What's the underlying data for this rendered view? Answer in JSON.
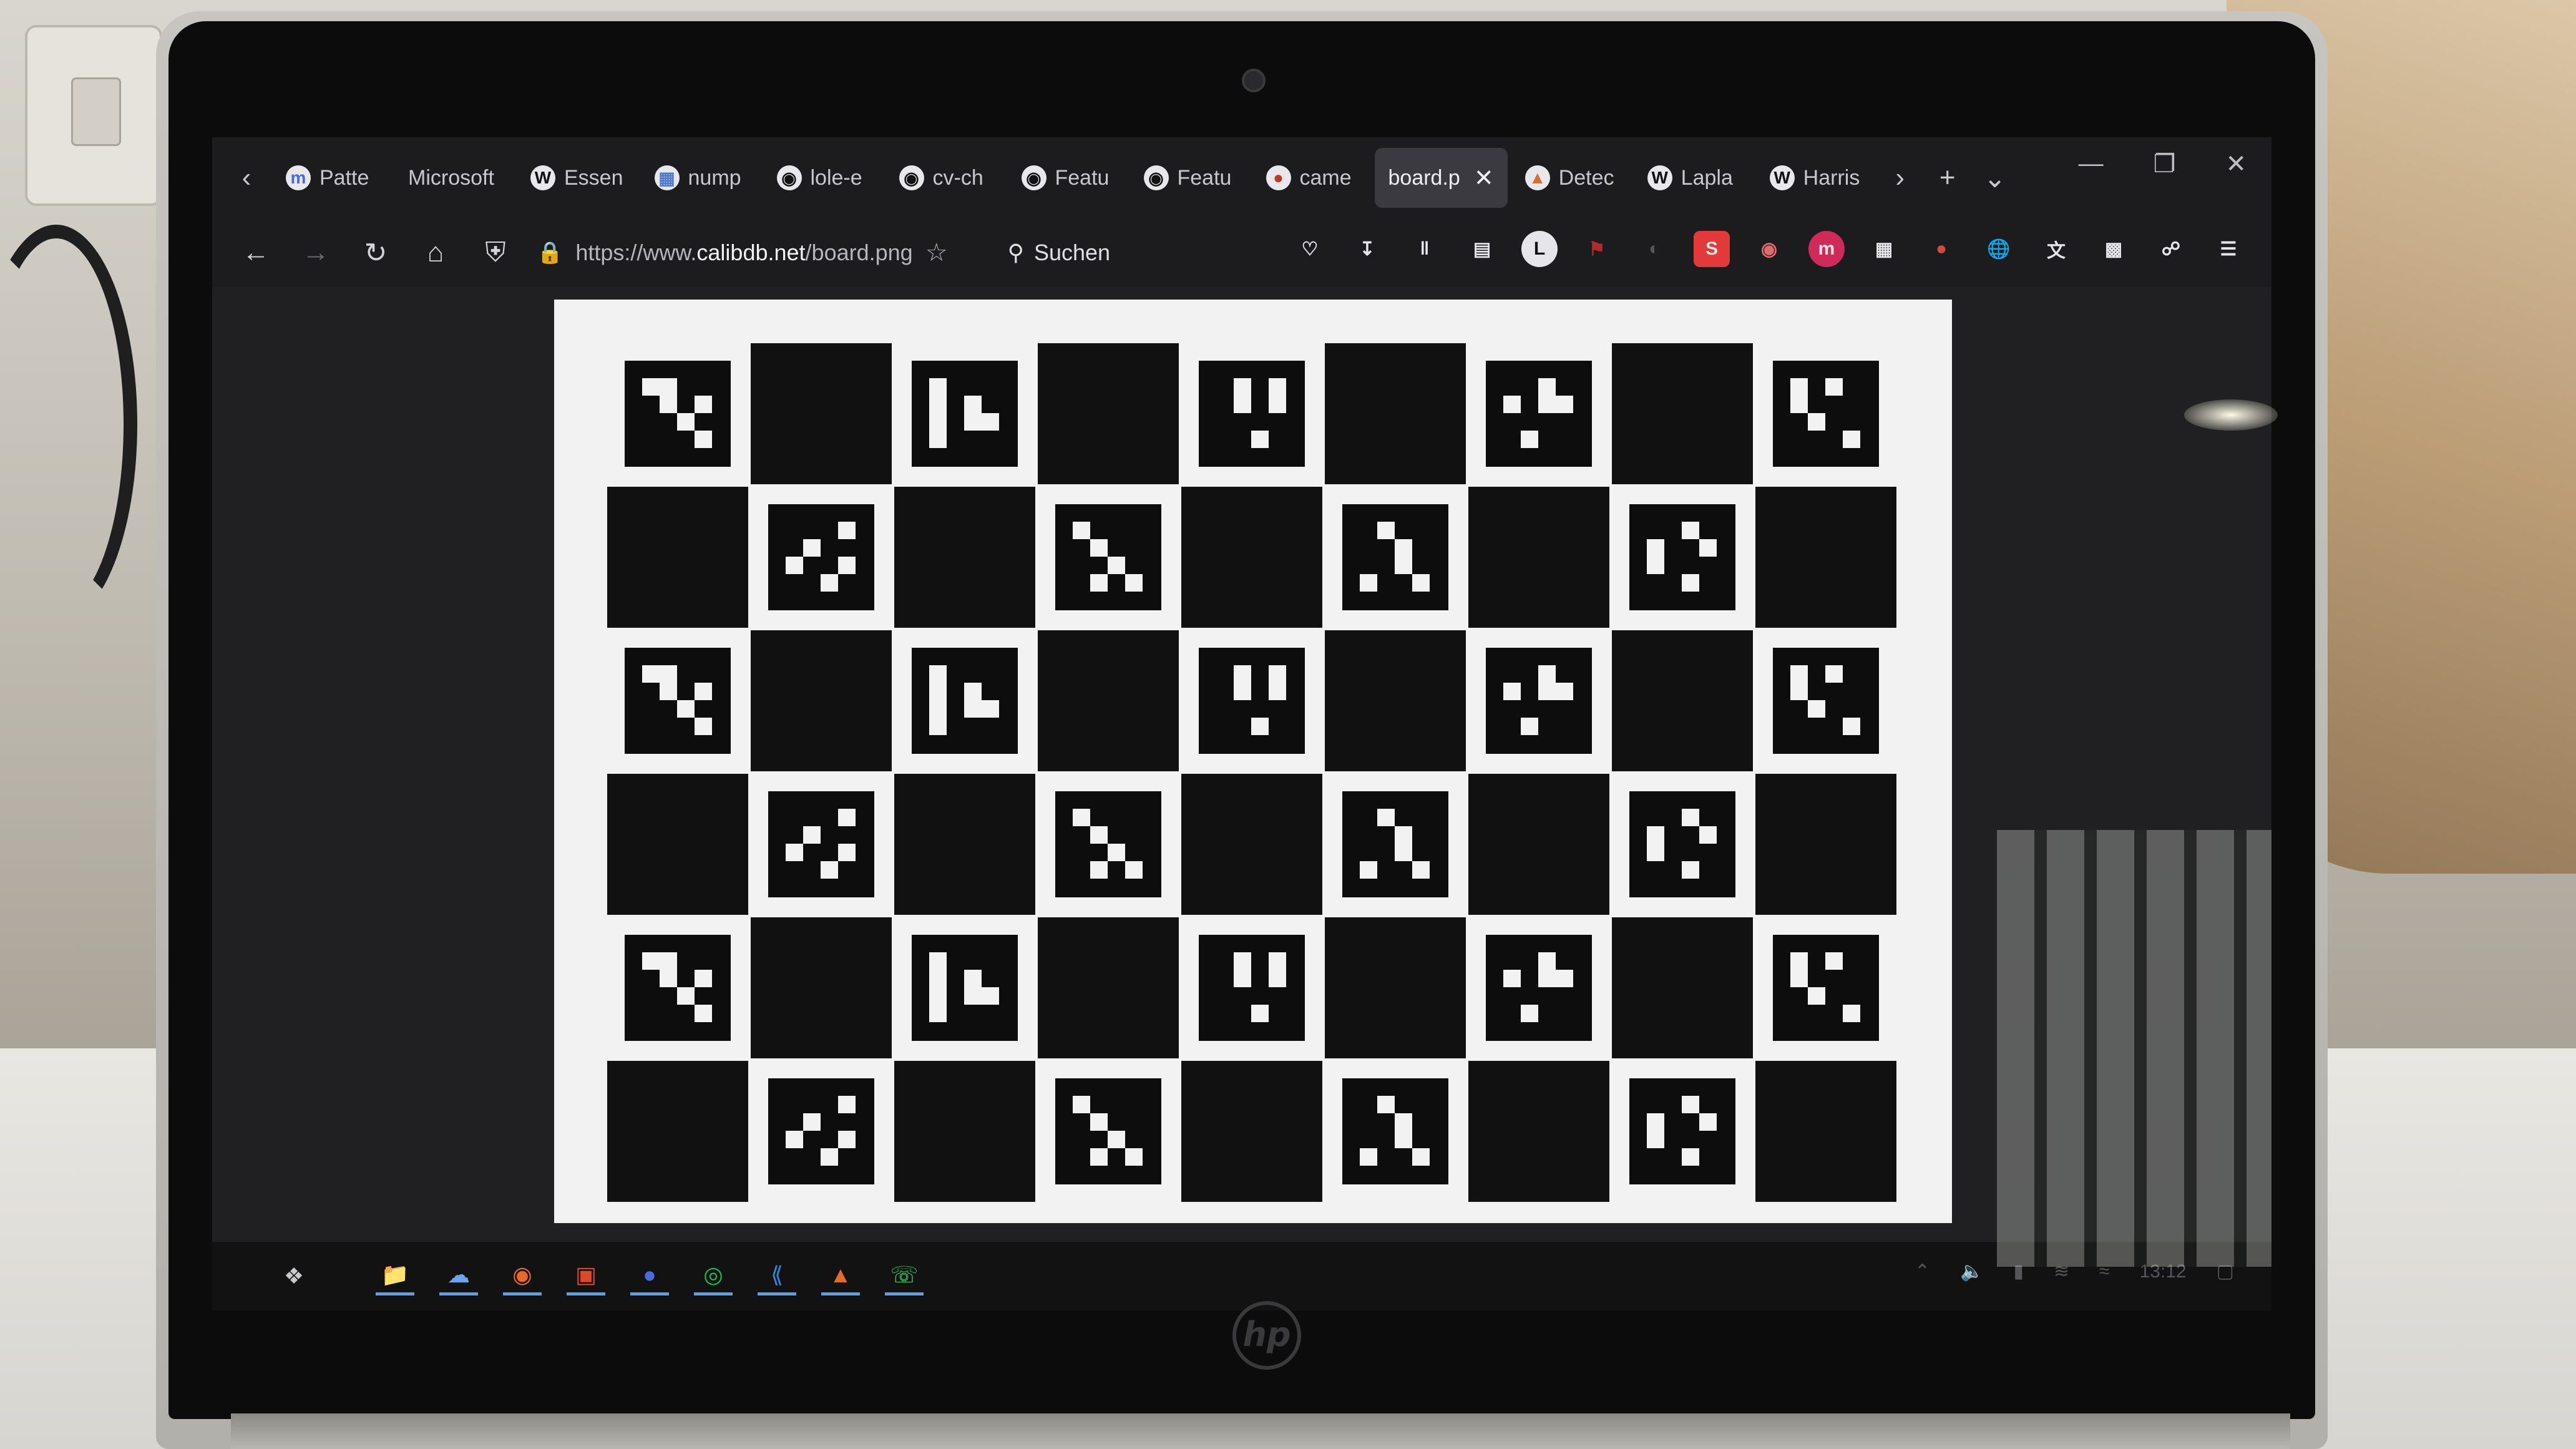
{
  "browser": {
    "tabs": [
      {
        "label": "Patte",
        "icon": "pattern-icon",
        "active": false
      },
      {
        "label": "Microsoft",
        "icon": "microsoft-icon",
        "active": false
      },
      {
        "label": "Essen",
        "icon": "wikipedia-icon",
        "active": false
      },
      {
        "label": "nump",
        "icon": "numpy-icon",
        "active": false
      },
      {
        "label": "lole-e",
        "icon": "github-icon",
        "active": false
      },
      {
        "label": "cv-ch",
        "icon": "github-icon",
        "active": false
      },
      {
        "label": "Featu",
        "icon": "github-icon",
        "active": false
      },
      {
        "label": "Featu",
        "icon": "github-icon",
        "active": false
      },
      {
        "label": "came",
        "icon": "camera-icon",
        "active": false
      },
      {
        "label": "board.p",
        "icon": "",
        "active": true
      },
      {
        "label": "Detec",
        "icon": "matlab-icon",
        "active": false
      },
      {
        "label": "Lapla",
        "icon": "wikipedia-icon",
        "active": false
      },
      {
        "label": "Harris",
        "icon": "wikipedia-icon",
        "active": false
      }
    ],
    "url_prefix": "https://www.",
    "url_domain": "calibdb.net",
    "url_path": "/board.png",
    "search_label": "Suchen"
  },
  "taskbar": {
    "clock": "13:12"
  },
  "laptop": {
    "brand": "hp"
  },
  "board": {
    "rows": 6,
    "cols": 9,
    "colors": {
      "black": "#111111",
      "white": "#f2f2f2"
    }
  }
}
